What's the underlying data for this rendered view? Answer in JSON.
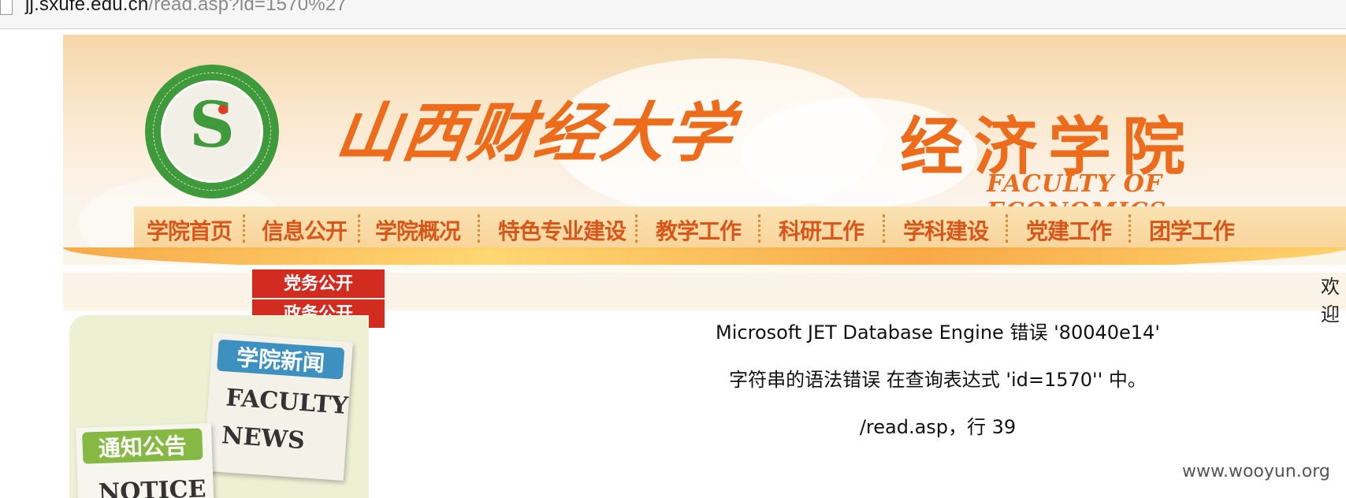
{
  "browser": {
    "url_host": "jj.sxufe.edu.cn",
    "url_path": "/read.asp?id=1570%27"
  },
  "banner": {
    "university_name": "山西财经大学",
    "faculty_name_cn": "经济学院",
    "faculty_name_en": "FACULTY OF ECONOMICS",
    "nav": [
      "学院首页",
      "信息公开",
      "学院概况",
      "特色专业建设",
      "教学工作",
      "科研工作",
      "学科建设",
      "党建工作",
      "团学工作"
    ],
    "welcome": "欢迎"
  },
  "dropdown": [
    "党务公开",
    "政务公开"
  ],
  "sidebar": {
    "news_cn": "学院新闻",
    "news_en_1": "FACULTY",
    "news_en_2": "NEWS",
    "notice_cn": "通知公告",
    "notice_en": "NOTICE"
  },
  "error": {
    "line1": "Microsoft JET Database Engine 错误 '80040e14'",
    "line2": "字符串的语法错误 在查询表达式 'id=1570'' 中。",
    "line3": "/read.asp，行 39"
  },
  "watermark": "www.wooyun.org"
}
